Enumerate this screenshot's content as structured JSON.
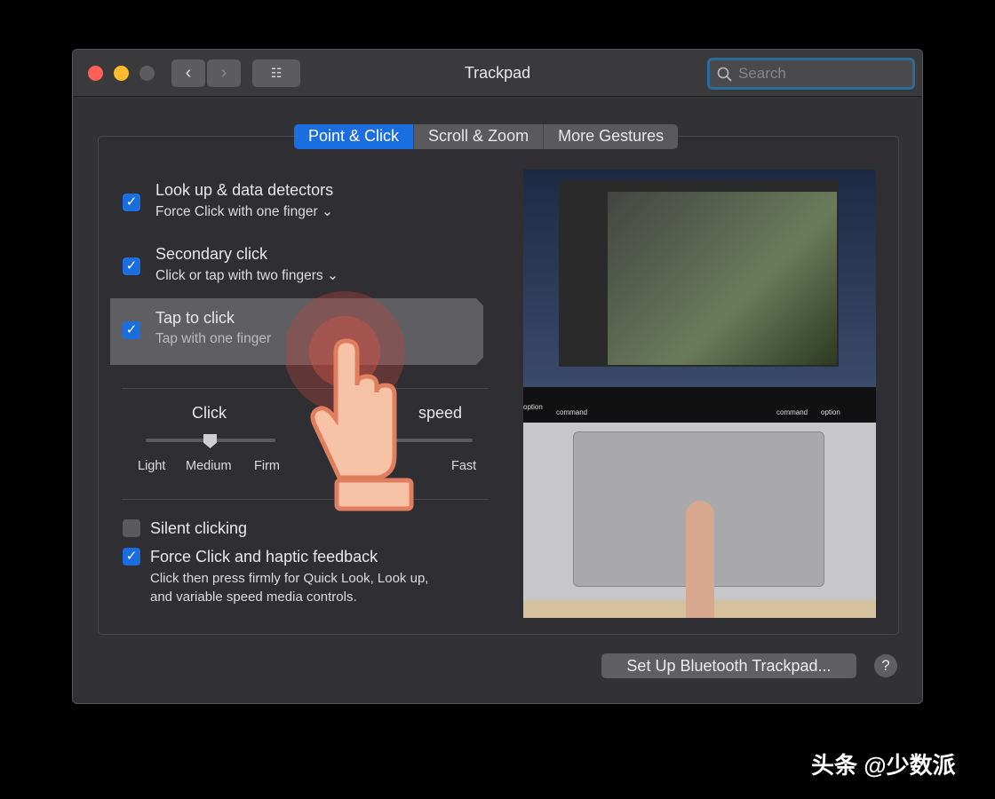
{
  "window": {
    "title": "Trackpad",
    "search_placeholder": "Search"
  },
  "tabs": [
    {
      "label": "Point & Click",
      "active": true
    },
    {
      "label": "Scroll & Zoom"
    },
    {
      "label": "More Gestures"
    }
  ],
  "options": [
    {
      "label": "Look up & data detectors",
      "sub": "Force Click with one finger",
      "checked": true
    },
    {
      "label": "Secondary click",
      "sub": "Click or tap with two fingers",
      "checked": true
    },
    {
      "label": "Tap to click",
      "sub": "Tap with one finger",
      "checked": true
    }
  ],
  "click_slider": {
    "label": "Click",
    "ticks": [
      "Light",
      "Medium",
      "Firm"
    ],
    "value": "Medium"
  },
  "tracking_slider": {
    "label": "speed",
    "max_label": "Fast"
  },
  "silent_clicking": {
    "label": "Silent clicking",
    "checked": false
  },
  "force_click": {
    "label": "Force Click and haptic feedback",
    "checked": true,
    "description_line1": "Click then press firmly for Quick Look, Look up,",
    "description_line2": "and variable speed media controls."
  },
  "keyboard": {
    "k1": "option",
    "k2": "command",
    "k3": "command",
    "k4": "option"
  },
  "footer": {
    "bluetooth_button": "Set Up Bluetooth Trackpad...",
    "help": "?"
  },
  "watermark": "头条 @少数派",
  "colors": {
    "accent": "#1b6ee0",
    "close": "#ff5f57",
    "minimize": "#febc2e"
  }
}
